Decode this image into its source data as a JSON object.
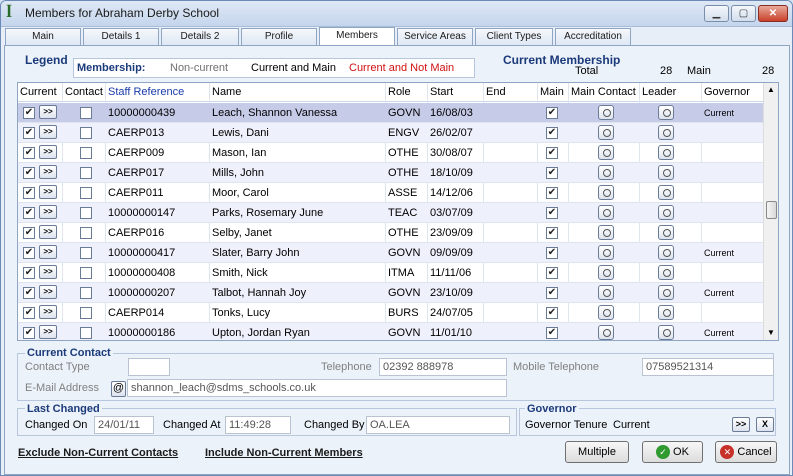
{
  "window": {
    "title": "Members for Abraham Derby School"
  },
  "tabs": [
    "Main",
    "Details 1",
    "Details 2",
    "Profile",
    "Members",
    "Service Areas",
    "Client Types",
    "Accreditation"
  ],
  "legend": {
    "label": "Legend",
    "membership_label": "Membership:",
    "non_current": "Non-current",
    "current_and_main": "Current and Main",
    "current_not_main": "Current and Not Main"
  },
  "current_membership": {
    "label": "Current Membership",
    "total_label": "Total",
    "total": "28",
    "main_label": "Main",
    "main": "28"
  },
  "grid": {
    "headers": {
      "current": "Current",
      "contact": "Contact",
      "staff_ref": "Staff Reference",
      "name": "Name",
      "role": "Role",
      "start": "Start",
      "end": "End",
      "main": "Main",
      "main_contact": "Main Contact",
      "leader": "Leader",
      "governor": "Governor"
    },
    "rows": [
      {
        "ref": "10000000439",
        "name": "Leach, Shannon Vanessa",
        "role": "GOVN",
        "start": "16/08/03",
        "end": "",
        "governor": "Current"
      },
      {
        "ref": "CAERP013",
        "name": "Lewis, Dani",
        "role": "ENGV",
        "start": "26/02/07",
        "end": "",
        "governor": ""
      },
      {
        "ref": "CAERP009",
        "name": "Mason, Ian",
        "role": "OTHE",
        "start": "30/08/07",
        "end": "",
        "governor": ""
      },
      {
        "ref": "CAERP017",
        "name": "Mills, John",
        "role": "OTHE",
        "start": "18/10/09",
        "end": "",
        "governor": ""
      },
      {
        "ref": "CAERP011",
        "name": "Moor, Carol",
        "role": "ASSE",
        "start": "14/12/06",
        "end": "",
        "governor": ""
      },
      {
        "ref": "10000000147",
        "name": "Parks, Rosemary June",
        "role": "TEAC",
        "start": "03/07/09",
        "end": "",
        "governor": ""
      },
      {
        "ref": "CAERP016",
        "name": "Selby, Janet",
        "role": "OTHE",
        "start": "23/09/09",
        "end": "",
        "governor": ""
      },
      {
        "ref": "10000000417",
        "name": "Slater, Barry John",
        "role": "GOVN",
        "start": "09/09/09",
        "end": "",
        "governor": "Current"
      },
      {
        "ref": "10000000408",
        "name": "Smith, Nick",
        "role": "ITMA",
        "start": "11/11/06",
        "end": "",
        "governor": ""
      },
      {
        "ref": "10000000207",
        "name": "Talbot, Hannah Joy",
        "role": "GOVN",
        "start": "23/10/09",
        "end": "",
        "governor": "Current"
      },
      {
        "ref": "CAERP014",
        "name": "Tonks, Lucy",
        "role": "BURS",
        "start": "24/07/05",
        "end": "",
        "governor": ""
      },
      {
        "ref": "10000000186",
        "name": "Upton, Jordan Ryan",
        "role": "GOVN",
        "start": "11/01/10",
        "end": "",
        "governor": "Current"
      }
    ],
    "arrow_label": ">>"
  },
  "current_contact": {
    "label": "Current Contact",
    "contact_type_label": "Contact Type",
    "contact_type": "",
    "telephone_label": "Telephone",
    "telephone": "02392 888978",
    "mobile_label": "Mobile Telephone",
    "mobile": "07589521314",
    "email_label": "E-Mail Address",
    "email_icon": "@",
    "email": "shannon_leach@sdms_schools.co.uk"
  },
  "last_changed": {
    "label": "Last Changed",
    "on_label": "Changed On",
    "on": "24/01/11",
    "at_label": "Changed At",
    "at": "11:49:28",
    "by_label": "Changed By",
    "by": "OA.LEA"
  },
  "governor": {
    "label": "Governor",
    "tenure_label": "Governor Tenure",
    "tenure": "Current",
    "go_label": ">>",
    "clear_label": "X"
  },
  "footer": {
    "exclude_link": "Exclude Non-Current Contacts",
    "include_link": "Include Non-Current Members",
    "multiple": "Multiple",
    "ok": "OK",
    "cancel": "Cancel"
  },
  "colors": {
    "accent": "#1b3a7a",
    "not_main": "#d01010",
    "selected_row": "#c6cbe8"
  }
}
